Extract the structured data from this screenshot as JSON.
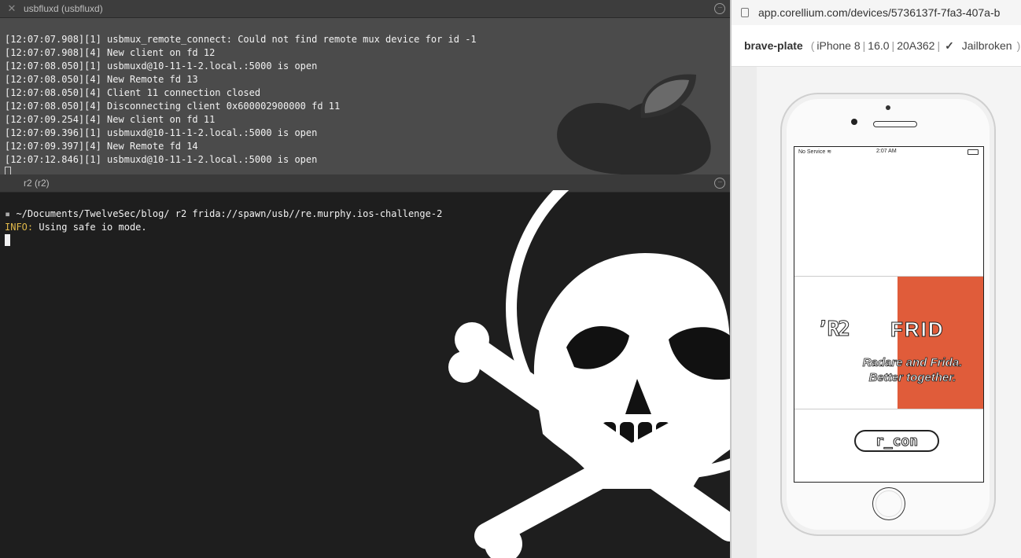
{
  "top_pane": {
    "tab_title": "usbfluxd (usbfluxd)",
    "lines": [
      "[12:07:07.908][1] usbmux_remote_connect: Could not find remote mux device for id -1",
      "[12:07:07.908][4] New client on fd 12",
      "[12:07:08.050][1] usbmuxd@10-11-1-2.local.:5000 is open",
      "[12:07:08.050][4] New Remote fd 13",
      "[12:07:08.050][4] Client 11 connection closed",
      "[12:07:08.050][4] Disconnecting client 0x600002900000 fd 11",
      "[12:07:09.254][4] New client on fd 11",
      "[12:07:09.396][1] usbmuxd@10-11-1-2.local.:5000 is open",
      "[12:07:09.397][4] New Remote fd 14",
      "[12:07:12.846][1] usbmuxd@10-11-1-2.local.:5000 is open"
    ]
  },
  "bottom_pane": {
    "tab_title": "r2 (r2)",
    "prompt": "~/Documents/TwelveSec/blog/ r2 frida://spawn/usb//re.murphy.ios-challenge-2",
    "info_label": "INFO:",
    "info_text": " Using safe io mode."
  },
  "browser": {
    "url": "app.corellium.com/devices/5736137f-7fa3-407a-b",
    "device_name": "brave-plate",
    "model": "iPhone 8",
    "version": "16.0",
    "build": "20A362",
    "jailbroken_label": "Jailbroken"
  },
  "phone": {
    "status_left": "No Service",
    "status_time": "2:07 AM",
    "banner_r2": "’R2",
    "banner_frida": "FRID",
    "tagline_line1": "Radare and Frida.",
    "tagline_line2": "Better together.",
    "rcon_label": "r_con"
  },
  "colors": {
    "info": "#e0b84a",
    "frida_red": "#e05c3a",
    "jailbroken_check": "#2aa84a"
  }
}
